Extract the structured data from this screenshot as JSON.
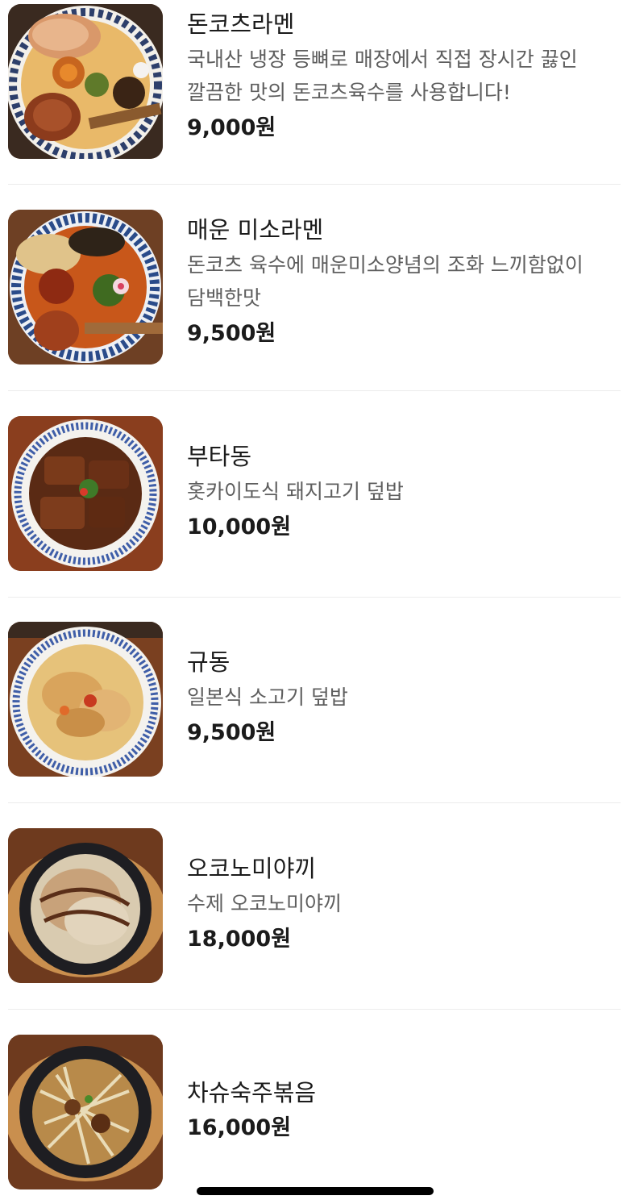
{
  "menu": {
    "items": [
      {
        "name": "돈코츠라멘",
        "description": "국내산 냉장 등뼈로 매장에서 직접 장시간 끓인 깔끔한 맛의 돈코츠육수를 사용합니다!",
        "price": "9,000원",
        "image_icon": "tonkotsu-ramen-photo"
      },
      {
        "name": "매운 미소라멘",
        "description": "돈코츠 육수에 매운미소양념의 조화 느끼함없이 담백한맛",
        "price": "9,500원",
        "image_icon": "spicy-miso-ramen-photo"
      },
      {
        "name": "부타동",
        "description": "홋카이도식 돼지고기 덮밥",
        "price": "10,000원",
        "image_icon": "butadon-photo"
      },
      {
        "name": "규동",
        "description": "일본식 소고기 덮밥",
        "price": "9,500원",
        "image_icon": "gyudon-photo"
      },
      {
        "name": "오코노미야끼",
        "description": "수제 오코노미야끼",
        "price": "18,000원",
        "image_icon": "okonomiyaki-photo"
      },
      {
        "name": "차슈숙주볶음",
        "description": "",
        "price": "16,000원",
        "image_icon": "chashu-bean-sprout-photo"
      }
    ]
  },
  "colors": {
    "text": "#1b1b1b",
    "description": "#5e5e5e",
    "divider": "#ececec"
  }
}
